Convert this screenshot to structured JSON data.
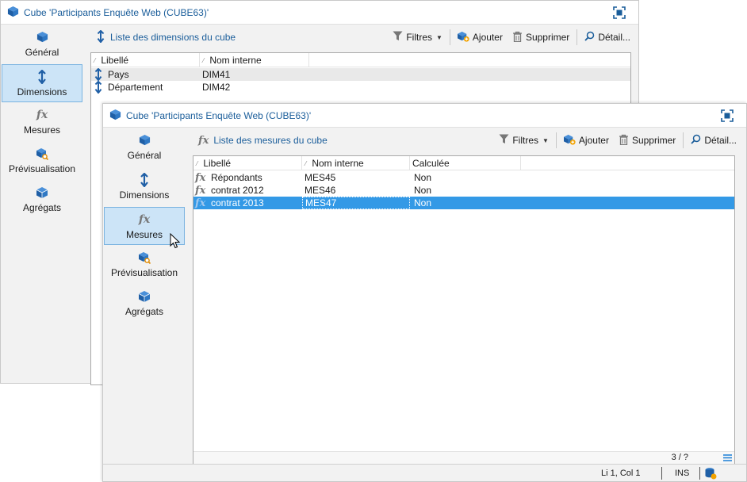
{
  "back_window": {
    "title": "Cube 'Participants Enquête Web (CUBE63)'",
    "sidebar": [
      {
        "label": "Général",
        "icon": "cube-icon"
      },
      {
        "label": "Dimensions",
        "icon": "dimension-arrow-icon",
        "active": true
      },
      {
        "label": "Mesures",
        "icon": "fx-icon"
      },
      {
        "label": "Prévisualisation",
        "icon": "preview-cube-icon"
      },
      {
        "label": "Agrégats",
        "icon": "aggregate-cube-icon"
      }
    ],
    "toolbar": {
      "list_title": "Liste des dimensions du cube",
      "filters_label": "Filtres",
      "add_label": "Ajouter",
      "delete_label": "Supprimer",
      "detail_label": "Détail..."
    },
    "grid": {
      "headers": [
        "Libellé",
        "Nom interne"
      ],
      "rows": [
        {
          "label": "Pays",
          "internal": "DIM41"
        },
        {
          "label": "Département",
          "internal": "DIM42"
        }
      ]
    }
  },
  "front_window": {
    "title": "Cube 'Participants Enquête Web (CUBE63)'",
    "sidebar": [
      {
        "label": "Général",
        "icon": "cube-icon"
      },
      {
        "label": "Dimensions",
        "icon": "dimension-arrow-icon"
      },
      {
        "label": "Mesures",
        "icon": "fx-icon",
        "active": true
      },
      {
        "label": "Prévisualisation",
        "icon": "preview-cube-icon"
      },
      {
        "label": "Agrégats",
        "icon": "aggregate-cube-icon"
      }
    ],
    "toolbar": {
      "list_title": "Liste des mesures du cube",
      "filters_label": "Filtres",
      "add_label": "Ajouter",
      "delete_label": "Supprimer",
      "detail_label": "Détail..."
    },
    "grid": {
      "headers": [
        "Libellé",
        "Nom interne",
        "Calculée"
      ],
      "rows": [
        {
          "label": "Répondants",
          "internal": "MES45",
          "calculated": "Non"
        },
        {
          "label": "contrat 2012",
          "internal": "MES46",
          "calculated": "Non"
        },
        {
          "label": "contrat 2013",
          "internal": "MES47",
          "calculated": "Non",
          "selected": true
        }
      ],
      "count": "3 / ?"
    },
    "statusbar": {
      "position": "Li 1, Col 1",
      "mode": "INS"
    }
  },
  "colors": {
    "accent": "#1a5d9a",
    "selection": "#3399e6",
    "active_sidebar": "#cce4f7"
  }
}
